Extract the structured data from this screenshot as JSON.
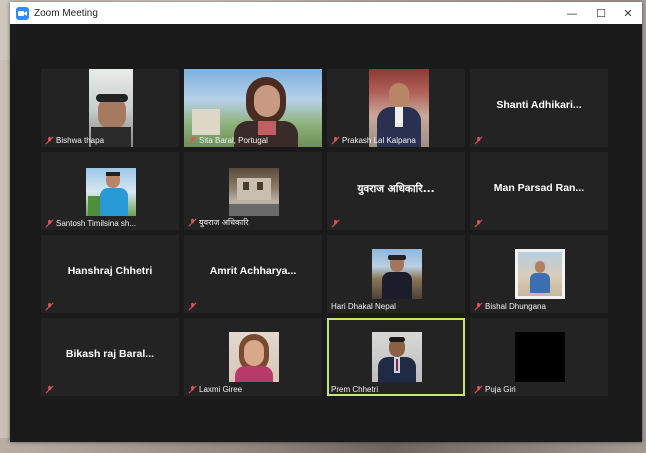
{
  "window": {
    "title": "Zoom Meeting",
    "minimize": "—",
    "maximize": "☐",
    "close": "✕"
  },
  "participants": [
    {
      "label": "Bishwa thapa",
      "video": true,
      "muted": true
    },
    {
      "label": "Sita Baral, Portugal",
      "video": true,
      "muted": true
    },
    {
      "label": "Prakash Lal Kalpana",
      "video": true,
      "muted": true
    },
    {
      "label": "",
      "display_name": "Shanti  Adhikari...",
      "video": false,
      "muted": true
    },
    {
      "label": "Santosh Timilsina sh...",
      "video": true,
      "muted": true
    },
    {
      "label": "युवराज अधिकारि",
      "video": true,
      "muted": true
    },
    {
      "label": "",
      "display_name": "युवराज अधिकारि...",
      "video": false,
      "muted": true
    },
    {
      "label": "",
      "display_name": "Man Parsad Ran...",
      "video": false,
      "muted": true
    },
    {
      "label": "",
      "display_name": "Hanshraj Chhetri",
      "video": false,
      "muted": true
    },
    {
      "label": "",
      "display_name": "Amrit  Achharya...",
      "video": false,
      "muted": true
    },
    {
      "label": "Hari Dhakal Nepal",
      "video": true,
      "muted": false
    },
    {
      "label": "Bishal Dhungana",
      "video": true,
      "muted": true
    },
    {
      "label": "",
      "display_name": "Bikash raj Baral...",
      "video": false,
      "muted": true
    },
    {
      "label": "Laxmi Giree",
      "video": true,
      "muted": true
    },
    {
      "label": "Prem Chhetri",
      "video": true,
      "muted": false,
      "active_speaker": true
    },
    {
      "label": "Puja Giri",
      "video": true,
      "muted": true
    }
  ]
}
